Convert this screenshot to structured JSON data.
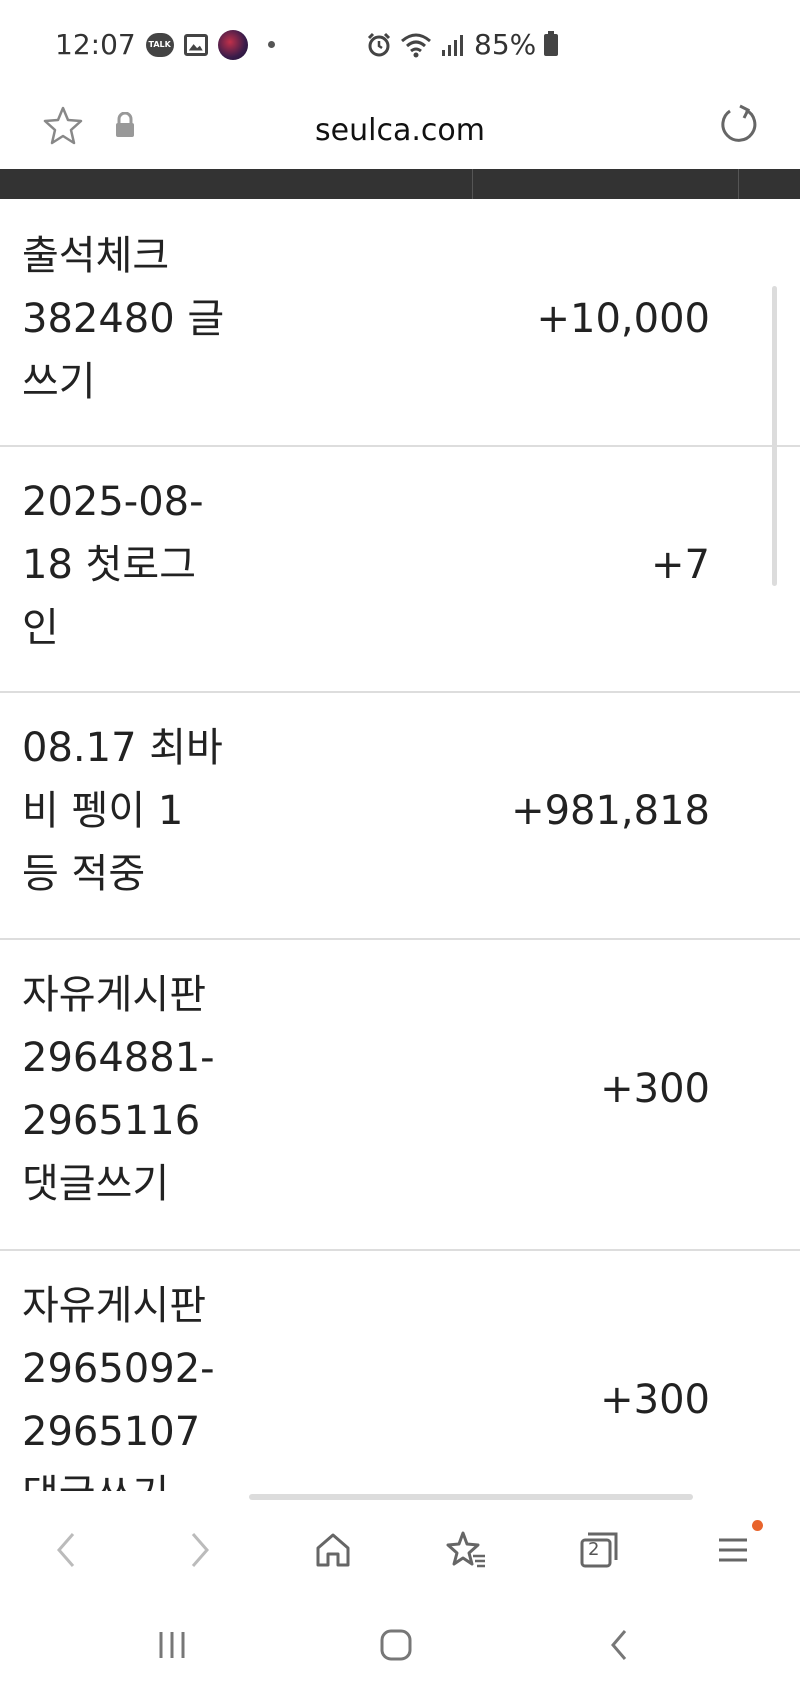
{
  "status_bar": {
    "time": "12:07",
    "talk_label": "TALK",
    "battery": "85%"
  },
  "browser": {
    "url": "seulca.com"
  },
  "points": [
    {
      "lines": [
        "출석체크",
        "382480 글",
        "쓰기"
      ],
      "amount": "+10,000"
    },
    {
      "lines": [
        "2025-08-",
        "18 첫로그",
        "인"
      ],
      "amount": "+7"
    },
    {
      "lines": [
        "08.17 최바",
        "비 펭이 1",
        "등 적중"
      ],
      "amount": "+981,818"
    },
    {
      "lines": [
        "자유게시판",
        "2964881-",
        "2965116",
        "댓글쓰기"
      ],
      "amount": "+300"
    },
    {
      "lines": [
        "자유게시판",
        "2965092-",
        "2965107",
        "댓글쓰기"
      ],
      "amount": "+300"
    }
  ],
  "toolbar": {
    "tabs_count": "2"
  },
  "colors": {
    "dark_strip": "#333333",
    "divider": "#dddddd",
    "notification": "#e8642c"
  },
  "icons": {
    "star": "star-icon",
    "lock": "lock-icon",
    "reload": "reload-icon",
    "back": "chevron-left-icon",
    "forward": "chevron-right-icon",
    "home": "home-icon",
    "bookmarks": "bookmark-star-icon",
    "tabs": "tabs-icon",
    "menu": "menu-icon"
  }
}
